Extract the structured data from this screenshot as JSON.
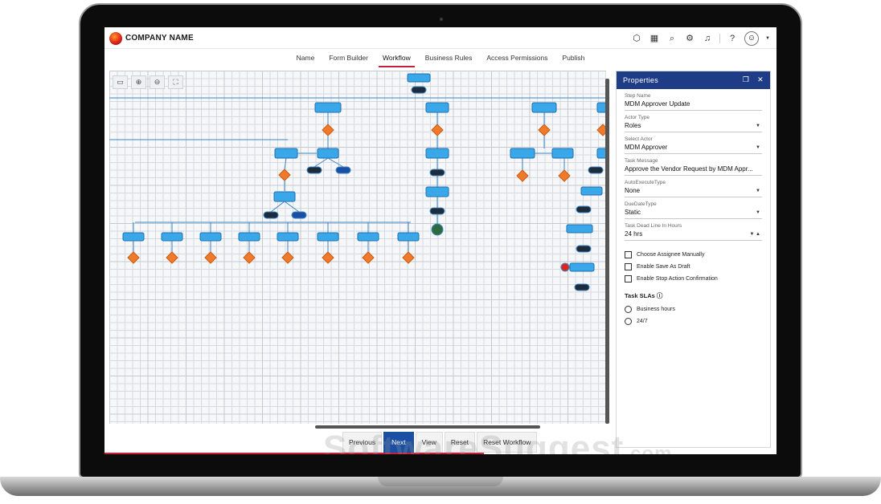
{
  "header": {
    "company_name": "COMPANY NAME",
    "icons": [
      "cube-icon",
      "calendar-icon",
      "search-icon",
      "tools-icon",
      "bell-icon",
      "help-icon",
      "user-icon"
    ]
  },
  "tabs": [
    {
      "label": "Name",
      "active": false
    },
    {
      "label": "Form Builder",
      "active": false
    },
    {
      "label": "Workflow",
      "active": true
    },
    {
      "label": "Business Rules",
      "active": false
    },
    {
      "label": "Access Permissions",
      "active": false
    },
    {
      "label": "Publish",
      "active": false
    }
  ],
  "canvas": {
    "zoom_tools": [
      "fit-icon",
      "zoom-in-icon",
      "zoom-out-icon",
      "fullscreen-icon"
    ]
  },
  "bottom": {
    "previous": "Previous",
    "next": "Next",
    "view": "View",
    "reset": "Reset",
    "reset_workflow": "Reset Workflow"
  },
  "properties": {
    "title": "Properties",
    "fields": [
      {
        "label": "Step Name",
        "value": "MDM Approver Update",
        "dropdown": false
      },
      {
        "label": "Actor Type",
        "value": "Roles",
        "dropdown": true
      },
      {
        "label": "Select Actor",
        "value": "MDM Approver",
        "dropdown": true
      },
      {
        "label": "Task Message",
        "value": "Approve the Vendor Request by MDM Appr...",
        "dropdown": false
      },
      {
        "label": "AutoExecuteType",
        "value": "None",
        "dropdown": true
      },
      {
        "label": "DueDateType",
        "value": "Static",
        "dropdown": true
      },
      {
        "label": "Task Dead Line In Hours",
        "value": "24 hrs",
        "dropdown": false
      }
    ],
    "checkboxes": [
      "Choose Assignee Manually",
      "Enable Save As Draft",
      "Enable Stop Action Confirmation"
    ],
    "sla_title": "Task SLAs",
    "sla_options": [
      "Business hours",
      "24/7"
    ]
  },
  "watermark": {
    "main": "SoftwareSuggest",
    "suffix": ".com"
  },
  "colors": {
    "brand_red": "#c6203a",
    "panel_blue": "#1f3d86",
    "node_blue": "#3aa8e8",
    "diamond_orange": "#f07a2a",
    "pill_dark": "#1d2b3a"
  }
}
